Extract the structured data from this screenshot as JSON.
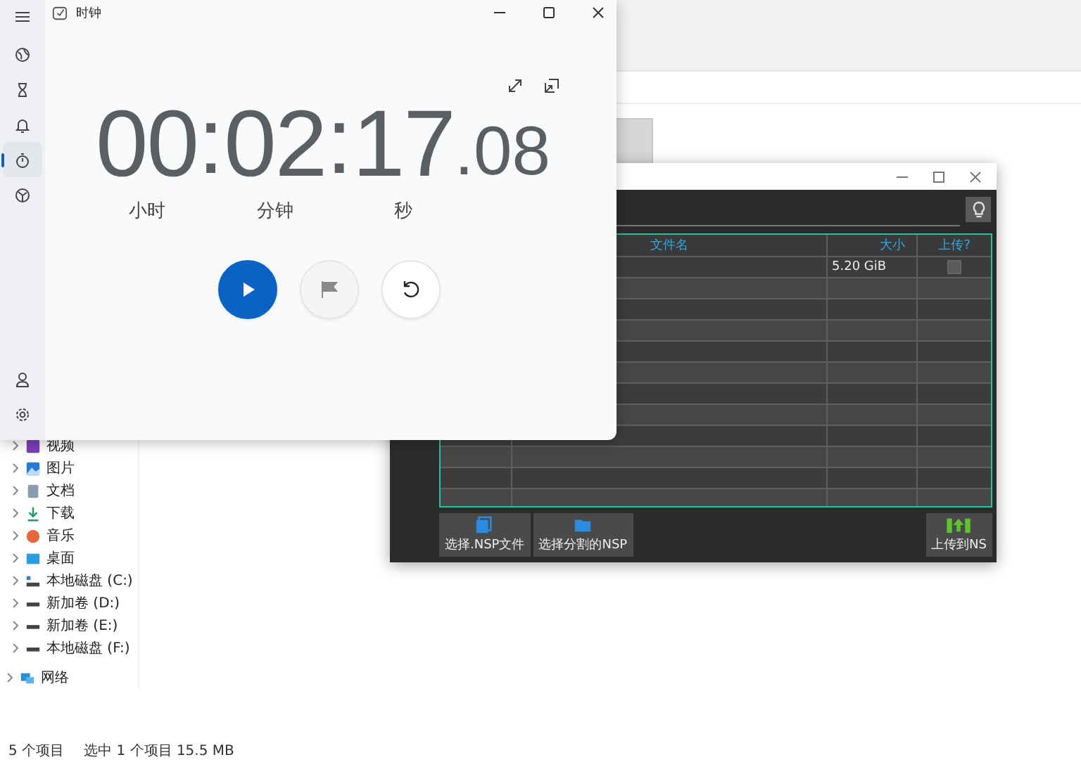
{
  "explorer": {
    "nav_items": [
      {
        "kind": "video",
        "label": "视频"
      },
      {
        "kind": "pictures",
        "label": "图片"
      },
      {
        "kind": "documents",
        "label": "文档"
      },
      {
        "kind": "downloads",
        "label": "下载"
      },
      {
        "kind": "music",
        "label": "音乐"
      },
      {
        "kind": "desktop",
        "label": "桌面"
      },
      {
        "kind": "system-drive",
        "label": "本地磁盘 (C:)"
      },
      {
        "kind": "drive",
        "label": "新加卷 (D:)"
      },
      {
        "kind": "drive",
        "label": "新加卷 (E:)"
      },
      {
        "kind": "drive",
        "label": "本地磁盘 (F:)"
      },
      {
        "kind": "network",
        "label": "网络"
      }
    ],
    "status_bar": {
      "item_count": "5 个项目",
      "selection": "选中 1 个项目  15.5 MB"
    }
  },
  "nsp_window": {
    "columns": [
      "文件名",
      "大小",
      "上传?"
    ],
    "rows": [
      {
        "name": "",
        "size": "5.20 GiB",
        "upload": false
      }
    ],
    "buttons": [
      {
        "kind": "nsp",
        "label": "选择.NSP文件"
      },
      {
        "kind": "split",
        "label": "选择分割的NSP"
      },
      {
        "kind": "upload",
        "label": "上传到NS"
      }
    ]
  },
  "clock": {
    "window": {
      "title": "时钟"
    },
    "nav": [
      {
        "kind": "world",
        "selected": false
      },
      {
        "kind": "timer",
        "selected": false
      },
      {
        "kind": "alarm",
        "selected": false
      },
      {
        "kind": "stopwatch",
        "selected": true
      },
      {
        "kind": "focus",
        "selected": false
      }
    ],
    "nav_bottom": [
      {
        "kind": "account"
      },
      {
        "kind": "settings"
      }
    ],
    "time": [
      {
        "kind": "unit",
        "value": "00",
        "label": "小时"
      },
      {
        "kind": "separator",
        "value": ":"
      },
      {
        "kind": "unit",
        "value": "02",
        "label": "分钟"
      },
      {
        "kind": "separator",
        "value": ":"
      },
      {
        "kind": "unit",
        "value": "17",
        "label": "秒"
      },
      {
        "kind": "fraction",
        "value": ".08"
      }
    ],
    "controls": [
      {
        "kind": "play",
        "disabled": false
      },
      {
        "kind": "lap",
        "disabled": true
      },
      {
        "kind": "reset",
        "disabled": false
      }
    ]
  }
}
